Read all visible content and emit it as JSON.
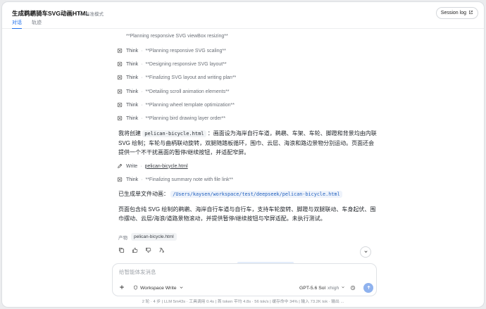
{
  "header": {
    "title": "生成鹈鹕骑车SVG动画HTML",
    "mode_label": "标准模式",
    "tabs": [
      {
        "label": "对话",
        "active": true
      },
      {
        "label": "轨迹",
        "active": false
      }
    ],
    "session_log_label": "Session log"
  },
  "timeline": {
    "top_line": "**Planning responsive SVG viewBox resizing**",
    "think_label": "Think",
    "write_label": "Write",
    "thinks_a": [
      "**Planning responsive SVG scaling**",
      "**Designing responsive SVG layout**",
      "**Finalizing SVG layout and writing plan**",
      "**Detailing scroll animation elements**",
      "**Planning wheel template optimization**",
      "**Planning bird drawing layer order**"
    ],
    "write_file": "pelican-bicycle.html",
    "think_b": "**Finalizing summary note with file link**"
  },
  "message": {
    "p1_lead": "我将创建",
    "p1_code": "pelican-bicycle.html",
    "p1_rest": "：画面设为海岸自行车道，鹈鹕、车架、车轮、脚蹬和背景均由内联 SVG 绘制；车轮与曲柄联动旋转，双腿随踏板循环，围巾、云层、海浪和路边景物分别运动。页面还会提供一个不干扰画面的暂停/继续按钮，并适配窄屏。",
    "p2_lead": "已生成单文件动画：",
    "p2_path": "/Users/kaysen/workspace/test/deepseek/pelican-bicycle.html",
    "p3": "页面包含纯 SVG 绘制的鹈鹕、海岸自行车道与自行车，支持车轮旋转、脚蹬与双腿联动、车身起伏、围巾摆动、云层/海浪/道路景物滚动，并提供暂停/继续按钮与窄屏适配。未执行测试。",
    "artifacts_label": "产物",
    "artifact_file": "pelican-bicycle.html"
  },
  "composer": {
    "placeholder": "给智能体发消息",
    "workspace_label": "Workspace Write",
    "model_label": "GPT-5.6 Sol",
    "effort_label": "xhigh"
  },
  "status_bar": {
    "text": "2 轮 · 4 步  |  LLM 5m43s · 工具调用 0.4s  |  首 token 平均 4.8s · 56 tok/s  |  缓存命中 34%  |  输入 73.2K tok · 输出 ..."
  },
  "colors": {
    "accent": "#1f6feb",
    "send_button": "#8fb2ee",
    "path_text": "#1f5fbf"
  }
}
